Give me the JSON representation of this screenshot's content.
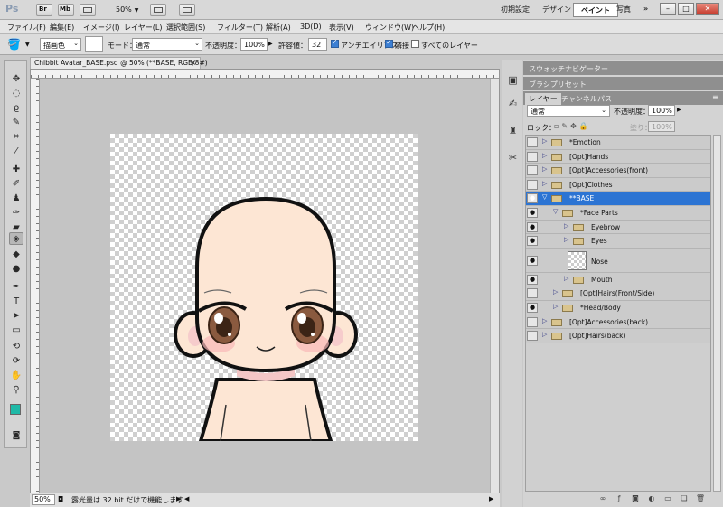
{
  "app": {
    "logo": "Ps",
    "bridge_icon": "Br",
    "minibridge_icon": "Mb",
    "zoom": "50%",
    "workspaces": [
      "初期設定",
      "デザイン",
      "ペイント",
      "写真"
    ],
    "more": "»"
  },
  "window_controls": {
    "minimize": "–",
    "restore": "□",
    "close": "✕"
  },
  "menu": [
    "ファイル(F)",
    "編集(E)",
    "イメージ(I)",
    "レイヤー(L)",
    "選択範囲(S)",
    "フィルター(T)",
    "解析(A)",
    "3D(D)",
    "表示(V)",
    "ウィンドウ(W)",
    "ヘルプ(H)"
  ],
  "options": {
    "fill_source": "描画色",
    "mode_label": "モード：",
    "mode_value": "通常",
    "opacity_label": "不透明度：",
    "opacity_value": "100%",
    "tolerance_label": "許容値：",
    "tolerance_value": "32",
    "antialias": "アンチエイリアス",
    "contiguous": "隣接",
    "all_layers": "すべてのレイヤー"
  },
  "document": {
    "tab_title": "Chibbit Avatar_BASE.psd @ 50% (**BASE, RGB/8#)",
    "close": "×"
  },
  "status": {
    "zoom": "50%",
    "text": "露光量は 32 bit だけで機能します"
  },
  "panels": {
    "top_tabs": [
      "スウォッチ",
      "ナビゲーター"
    ],
    "brush_tab": "ブラシプリセット",
    "layer_tabs": [
      "レイヤー",
      "チャンネル",
      "パス"
    ],
    "blend_mode": "通常",
    "opacity_label": "不透明度：",
    "opacity_value": "100%",
    "lock_label": "ロック：",
    "fill_label": "塗り：",
    "fill_value": "100%"
  },
  "layers": [
    {
      "name": "*Emotion",
      "visible": false,
      "indent": 0,
      "expanded": false,
      "kind": "group"
    },
    {
      "name": "[Opt]Hands",
      "visible": false,
      "indent": 0,
      "expanded": false,
      "kind": "group"
    },
    {
      "name": "[Opt]Accessories(front)",
      "visible": false,
      "indent": 0,
      "expanded": false,
      "kind": "group"
    },
    {
      "name": "[Opt]Clothes",
      "visible": false,
      "indent": 0,
      "expanded": false,
      "kind": "group"
    },
    {
      "name": "**BASE",
      "visible": true,
      "indent": 0,
      "expanded": true,
      "kind": "group",
      "selected": true
    },
    {
      "name": "*Face Parts",
      "visible": true,
      "indent": 1,
      "expanded": true,
      "kind": "group"
    },
    {
      "name": "Eyebrow",
      "visible": true,
      "indent": 2,
      "expanded": false,
      "kind": "group"
    },
    {
      "name": "Eyes",
      "visible": true,
      "indent": 2,
      "expanded": false,
      "kind": "group"
    },
    {
      "name": "Nose",
      "visible": true,
      "indent": 2,
      "kind": "layer"
    },
    {
      "name": "Mouth",
      "visible": true,
      "indent": 2,
      "expanded": false,
      "kind": "group"
    },
    {
      "name": "[Opt]Hairs(Front/Side)",
      "visible": false,
      "indent": 1,
      "expanded": false,
      "kind": "group"
    },
    {
      "name": "*Head/Body",
      "visible": true,
      "indent": 1,
      "expanded": false,
      "kind": "group"
    },
    {
      "name": "[Opt]Accessories(back)",
      "visible": false,
      "indent": 0,
      "expanded": false,
      "kind": "group"
    },
    {
      "name": "[Opt]Hairs(back)",
      "visible": false,
      "indent": 0,
      "expanded": false,
      "kind": "group"
    }
  ],
  "colors": {
    "foreground": "#1fb9a7",
    "background": "#ffffff",
    "selection": "#2c74d3",
    "skin": "#fde6d4",
    "iris": "#8a5a3f"
  }
}
